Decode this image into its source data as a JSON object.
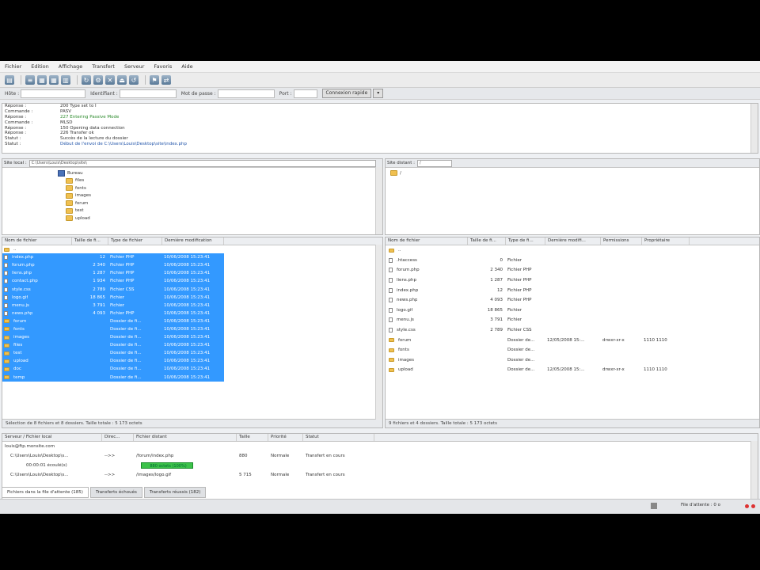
{
  "menu": [
    "Fichier",
    "Edition",
    "Affichage",
    "Transfert",
    "Serveur",
    "Favoris",
    "Aide"
  ],
  "quickconnect": {
    "host_label": "Hôte :",
    "user_label": "Identifiant :",
    "pass_label": "Mot de passe :",
    "port_label": "Port :",
    "button": "Connexion rapide"
  },
  "log": [
    {
      "k": "Réponse :",
      "v": "200 Type set to I",
      "c": ""
    },
    {
      "k": "Commande :",
      "v": "PASV",
      "c": ""
    },
    {
      "k": "Réponse :",
      "v": "227 Entering Passive Mode",
      "c": "green"
    },
    {
      "k": "Commande :",
      "v": "MLSD",
      "c": ""
    },
    {
      "k": "Réponse :",
      "v": "150 Opening data connection",
      "c": ""
    },
    {
      "k": "Réponse :",
      "v": "226 Transfer ok",
      "c": ""
    },
    {
      "k": "Statut :",
      "v": "Succès de la lecture du dossier",
      "c": ""
    },
    {
      "k": "Statut :",
      "v": "Début de l'envoi de C:\\Users\\Louis\\Desktop\\site\\index.php",
      "c": "blue"
    }
  ],
  "local": {
    "addr_label": "Site local :",
    "addr_value": "C:\\Users\\Louis\\Desktop\\site\\",
    "tree": [
      {
        "label": "Bureau",
        "kind": "drive"
      },
      {
        "label": "files",
        "kind": "folder"
      },
      {
        "label": "fonts",
        "kind": "folder"
      },
      {
        "label": "images",
        "kind": "folder"
      },
      {
        "label": "forum",
        "kind": "folder"
      },
      {
        "label": "test",
        "kind": "folder"
      },
      {
        "label": "upload",
        "kind": "folder"
      }
    ],
    "columns": [
      "Nom de fichier",
      "Taille de fi...",
      "Type de fichier",
      "Dernière modification"
    ],
    "files": [
      {
        "name": "..",
        "size": "",
        "type": "",
        "date": "",
        "kind": "folder",
        "sel": false
      },
      {
        "name": "index.php",
        "size": "12",
        "type": "Fichier PHP",
        "date": "10/06/2008 15:23:41",
        "kind": "file",
        "sel": true
      },
      {
        "name": "forum.php",
        "size": "2 340",
        "type": "Fichier PHP",
        "date": "10/06/2008 15:23:41",
        "kind": "file",
        "sel": true
      },
      {
        "name": "liens.php",
        "size": "1 287",
        "type": "Fichier PHP",
        "date": "10/06/2008 15:23:41",
        "kind": "file",
        "sel": true
      },
      {
        "name": "contact.php",
        "size": "1 934",
        "type": "Fichier PHP",
        "date": "10/06/2008 15:23:41",
        "kind": "file",
        "sel": true
      },
      {
        "name": "style.css",
        "size": "2 789",
        "type": "Fichier CSS",
        "date": "10/06/2008 15:23:41",
        "kind": "file",
        "sel": true
      },
      {
        "name": "logo.gif",
        "size": "18 865",
        "type": "Fichier",
        "date": "10/06/2008 15:23:41",
        "kind": "file",
        "sel": true
      },
      {
        "name": "menu.js",
        "size": "3 791",
        "type": "Fichier",
        "date": "10/06/2008 15:23:41",
        "kind": "file",
        "sel": true
      },
      {
        "name": "news.php",
        "size": "4 093",
        "type": "Fichier PHP",
        "date": "10/06/2008 15:23:41",
        "kind": "file",
        "sel": true
      },
      {
        "name": "forum",
        "size": "",
        "type": "Dossier de fi...",
        "date": "10/06/2008 15:23:41",
        "kind": "folder",
        "sel": true
      },
      {
        "name": "fonts",
        "size": "",
        "type": "Dossier de fi...",
        "date": "10/06/2008 15:23:41",
        "kind": "folder",
        "sel": true
      },
      {
        "name": "images",
        "size": "",
        "type": "Dossier de fi...",
        "date": "10/06/2008 15:23:41",
        "kind": "folder",
        "sel": true
      },
      {
        "name": "files",
        "size": "",
        "type": "Dossier de fi...",
        "date": "10/06/2008 15:23:41",
        "kind": "folder",
        "sel": true
      },
      {
        "name": "test",
        "size": "",
        "type": "Dossier de fi...",
        "date": "10/06/2008 15:23:41",
        "kind": "folder",
        "sel": true
      },
      {
        "name": "upload",
        "size": "",
        "type": "Dossier de fi...",
        "date": "10/06/2008 15:23:41",
        "kind": "folder",
        "sel": true
      },
      {
        "name": "doc",
        "size": "",
        "type": "Dossier de fi...",
        "date": "10/06/2008 15:23:41",
        "kind": "folder",
        "sel": true
      },
      {
        "name": "temp",
        "size": "",
        "type": "Dossier de fi...",
        "date": "10/06/2008 15:23:41",
        "kind": "folder",
        "sel": true
      }
    ],
    "status": "Sélection de 8 fichiers et 8 dossiers. Taille totale : 5 173 octets"
  },
  "remote": {
    "addr_label": "Site distant :",
    "addr_value": "/",
    "tree_root": "/",
    "columns": [
      "Nom de fichier",
      "Taille de fi...",
      "Type de fi...",
      "Dernière modifi...",
      "Permissions",
      "Propriétaire"
    ],
    "files": [
      {
        "name": "..",
        "size": "",
        "type": "",
        "date": "",
        "perm": "",
        "owner": "",
        "kind": "folder"
      },
      {
        "name": ".htaccess",
        "size": "0",
        "type": "Fichier",
        "date": "",
        "perm": "",
        "owner": "",
        "kind": "file"
      },
      {
        "name": "forum.php",
        "size": "2 340",
        "type": "Fichier PHP",
        "date": "",
        "perm": "",
        "owner": "",
        "kind": "file"
      },
      {
        "name": "liens.php",
        "size": "1 287",
        "type": "Fichier PHP",
        "date": "",
        "perm": "",
        "owner": "",
        "kind": "file"
      },
      {
        "name": "index.php",
        "size": "12",
        "type": "Fichier PHP",
        "date": "",
        "perm": "",
        "owner": "",
        "kind": "file"
      },
      {
        "name": "news.php",
        "size": "4 093",
        "type": "Fichier PHP",
        "date": "",
        "perm": "",
        "owner": "",
        "kind": "file"
      },
      {
        "name": "logo.gif",
        "size": "18 865",
        "type": "Fichier",
        "date": "",
        "perm": "",
        "owner": "",
        "kind": "file"
      },
      {
        "name": "menu.js",
        "size": "3 791",
        "type": "Fichier",
        "date": "",
        "perm": "",
        "owner": "",
        "kind": "file"
      },
      {
        "name": "style.css",
        "size": "2 789",
        "type": "Fichier CSS",
        "date": "",
        "perm": "",
        "owner": "",
        "kind": "file"
      },
      {
        "name": "forum",
        "size": "",
        "type": "Dossier de...",
        "date": "12/05/2008 15:...",
        "perm": "drwxr-xr-x",
        "owner": "1110 1110",
        "kind": "folder"
      },
      {
        "name": "fonts",
        "size": "",
        "type": "Dossier de...",
        "date": "",
        "perm": "",
        "owner": "",
        "kind": "folder"
      },
      {
        "name": "images",
        "size": "",
        "type": "Dossier de...",
        "date": "",
        "perm": "",
        "owner": "",
        "kind": "folder"
      },
      {
        "name": "upload",
        "size": "",
        "type": "Dossier de...",
        "date": "12/05/2008 15:...",
        "perm": "drwxr-xr-x",
        "owner": "1110 1110",
        "kind": "folder"
      }
    ],
    "status": "9 fichiers et 4 dossiers. Taille totale : 5 173 octets"
  },
  "queue": {
    "columns": [
      "Serveur / Fichier local",
      "Direc...",
      "Fichier distant",
      "Taille",
      "Priorité",
      "Statut"
    ],
    "rows": [
      {
        "local": "louis@ftp.monsite.com",
        "dir": "",
        "remote": "",
        "size": "",
        "prio": "",
        "status": "",
        "progress": ""
      },
      {
        "local": "C:\\Users\\Louis\\Desktop\\s...",
        "dir": "-->>",
        "remote": "/forum/index.php",
        "size": "880",
        "prio": "Normale",
        "status": "Transfert en cours",
        "progress": ""
      },
      {
        "local": "00:00:01 écoulé(s)",
        "dir": "",
        "remote": "",
        "size": "",
        "prio": "",
        "status": "",
        "progress": "880 octets (100%)"
      },
      {
        "local": "C:\\Users\\Louis\\Desktop\\s...",
        "dir": "-->>",
        "remote": "/images/logo.gif",
        "size": "5 715",
        "prio": "Normale",
        "status": "Transfert en cours",
        "progress": ""
      }
    ]
  },
  "tabs": [
    "Fichiers dans la file d'attente (185)",
    "Transferts échoués",
    "Transferts réussis (182)"
  ],
  "bottom": {
    "queue_label": "File d'attente : 0 o"
  }
}
